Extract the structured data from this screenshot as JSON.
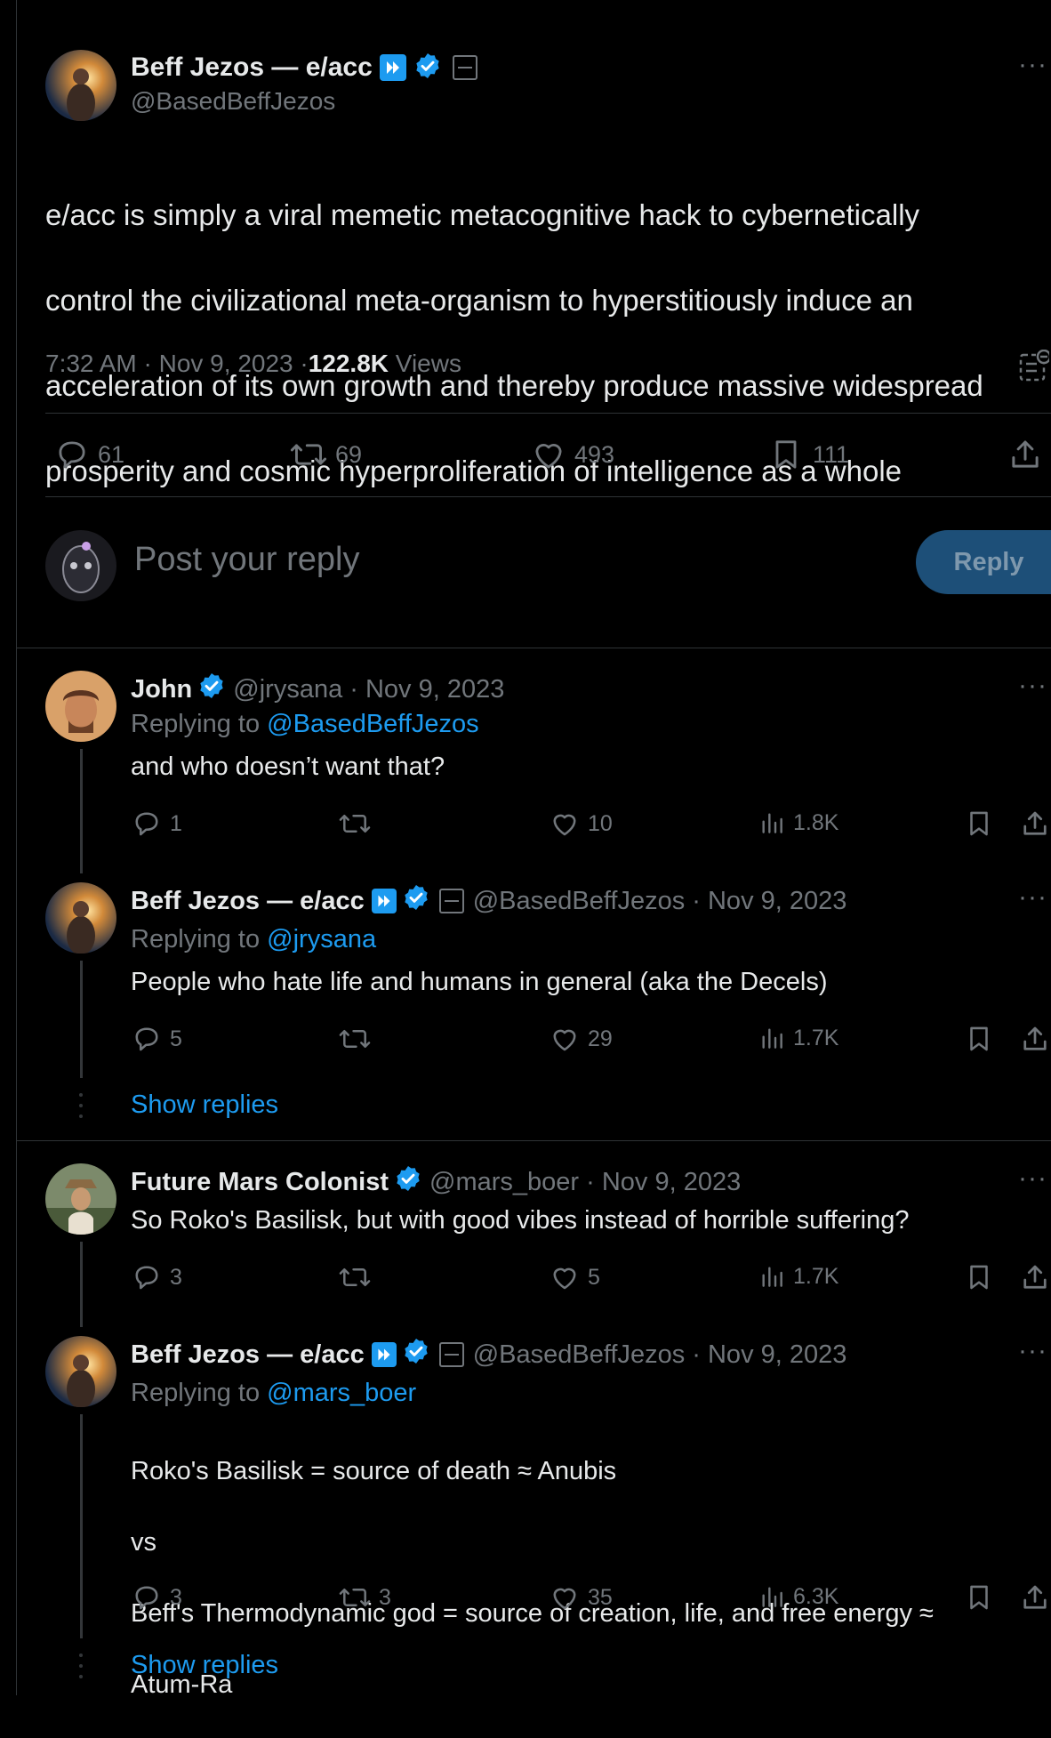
{
  "main": {
    "author_name": "Beff Jezos — e/acc",
    "handle": "@BasedBeffJezos",
    "text_lines": [
      "e/acc is simply a viral memetic metacognitive hack to cybernetically",
      "control the civilizational meta-organism to hyperstitiously induce an",
      "acceleration of its own growth and thereby produce massive widespread",
      "prosperity and cosmic hyperproliferation of intelligence as a whole"
    ],
    "time": "7:32 AM · Nov 9, 2023 · ",
    "views_count": "122.8K",
    "views_label": " Views",
    "replies": "61",
    "reposts": "69",
    "likes": "493",
    "bookmarks": "111"
  },
  "composer": {
    "placeholder": "Post your reply",
    "reply_button": "Reply"
  },
  "replies": [
    {
      "name": "John",
      "meta": "@jrysana · Nov 9, 2023",
      "replying_prefix": "Replying to ",
      "replying_to": "@BasedBeffJezos",
      "text": "and who doesn’t want that?",
      "replies": "1",
      "reposts": "",
      "likes": "10",
      "views": "1.8K"
    },
    {
      "name": "Beff Jezos — e/acc",
      "meta": "@BasedBeffJezos · Nov 9, 2023",
      "replying_prefix": "Replying to ",
      "replying_to": "@jrysana",
      "text": "People who hate life and humans in general (aka the Decels)",
      "replies": "5",
      "reposts": "",
      "likes": "29",
      "views": "1.7K",
      "show_replies": "Show replies"
    },
    {
      "name": "Future Mars Colonist",
      "meta": "@mars_boer · Nov 9, 2023",
      "text": "So Roko's Basilisk, but with good vibes instead of horrible suffering?",
      "replies": "3",
      "reposts": "",
      "likes": "5",
      "views": "1.7K"
    },
    {
      "name": "Beff Jezos — e/acc",
      "meta": "@BasedBeffJezos · Nov 9, 2023",
      "replying_prefix": "Replying to ",
      "replying_to": "@mars_boer",
      "text_lines": [
        "Roko's Basilisk = source of death ≈ Anubis",
        "vs",
        "Beff's Thermodynamic god = source of creation, life, and free energy ≈",
        "Atum-Ra"
      ],
      "replies": "3",
      "reposts": "3",
      "likes": "35",
      "views": "6.3K",
      "show_replies": "Show replies"
    }
  ],
  "colors": {
    "background": "#000000",
    "text": "#e7e9ea",
    "muted": "#71767b",
    "link": "#1d9bf0",
    "reply_button": "#1d4f78",
    "divider": "#2f3336"
  }
}
